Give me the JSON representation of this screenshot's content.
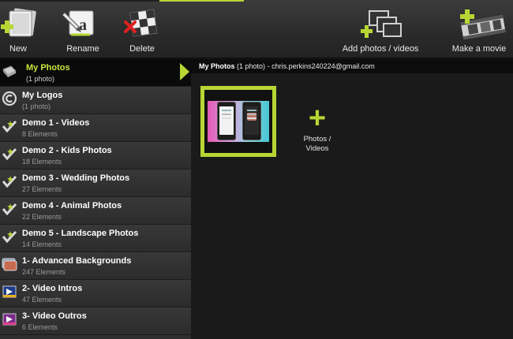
{
  "toolbar": {
    "new_label": "New",
    "rename_label": "Rename",
    "delete_label": "Delete",
    "add_label": "Add photos / videos",
    "movie_label": "Make a movie",
    "accent_color": "#b7d634"
  },
  "sidebar": {
    "items": [
      {
        "title": "My Photos",
        "sub": "(1 photo)",
        "icon": "photo-stack-icon"
      },
      {
        "title": "My Logos",
        "sub": "(1 photo)",
        "icon": "copyright-icon"
      },
      {
        "title": "Demo 1 - Videos",
        "sub": "8 Elements",
        "icon": "star-check-icon"
      },
      {
        "title": "Demo 2 - Kids Photos",
        "sub": "18 Elements",
        "icon": "star-check-icon"
      },
      {
        "title": "Demo 3 - Wedding Photos",
        "sub": "27 Elements",
        "icon": "star-check-icon"
      },
      {
        "title": "Demo 4 - Animal Photos",
        "sub": "22 Elements",
        "icon": "star-check-icon"
      },
      {
        "title": "Demo 5 - Landscape Photos",
        "sub": "14 Elements",
        "icon": "star-check-icon"
      },
      {
        "title": "1- Advanced Backgrounds",
        "sub": "247 Elements",
        "icon": "backgrounds-icon"
      },
      {
        "title": "2- Video Intros",
        "sub": "47 Elements",
        "icon": "video-intro-icon"
      },
      {
        "title": "3- Video Outros",
        "sub": "6 Elements",
        "icon": "video-outro-icon"
      }
    ]
  },
  "main": {
    "header_title": "My Photos",
    "header_count": "(1 photo)",
    "header_email": "- chris.perkins240224@gmail.com",
    "add_label_line1": "Photos /",
    "add_label_line2": "Videos"
  }
}
